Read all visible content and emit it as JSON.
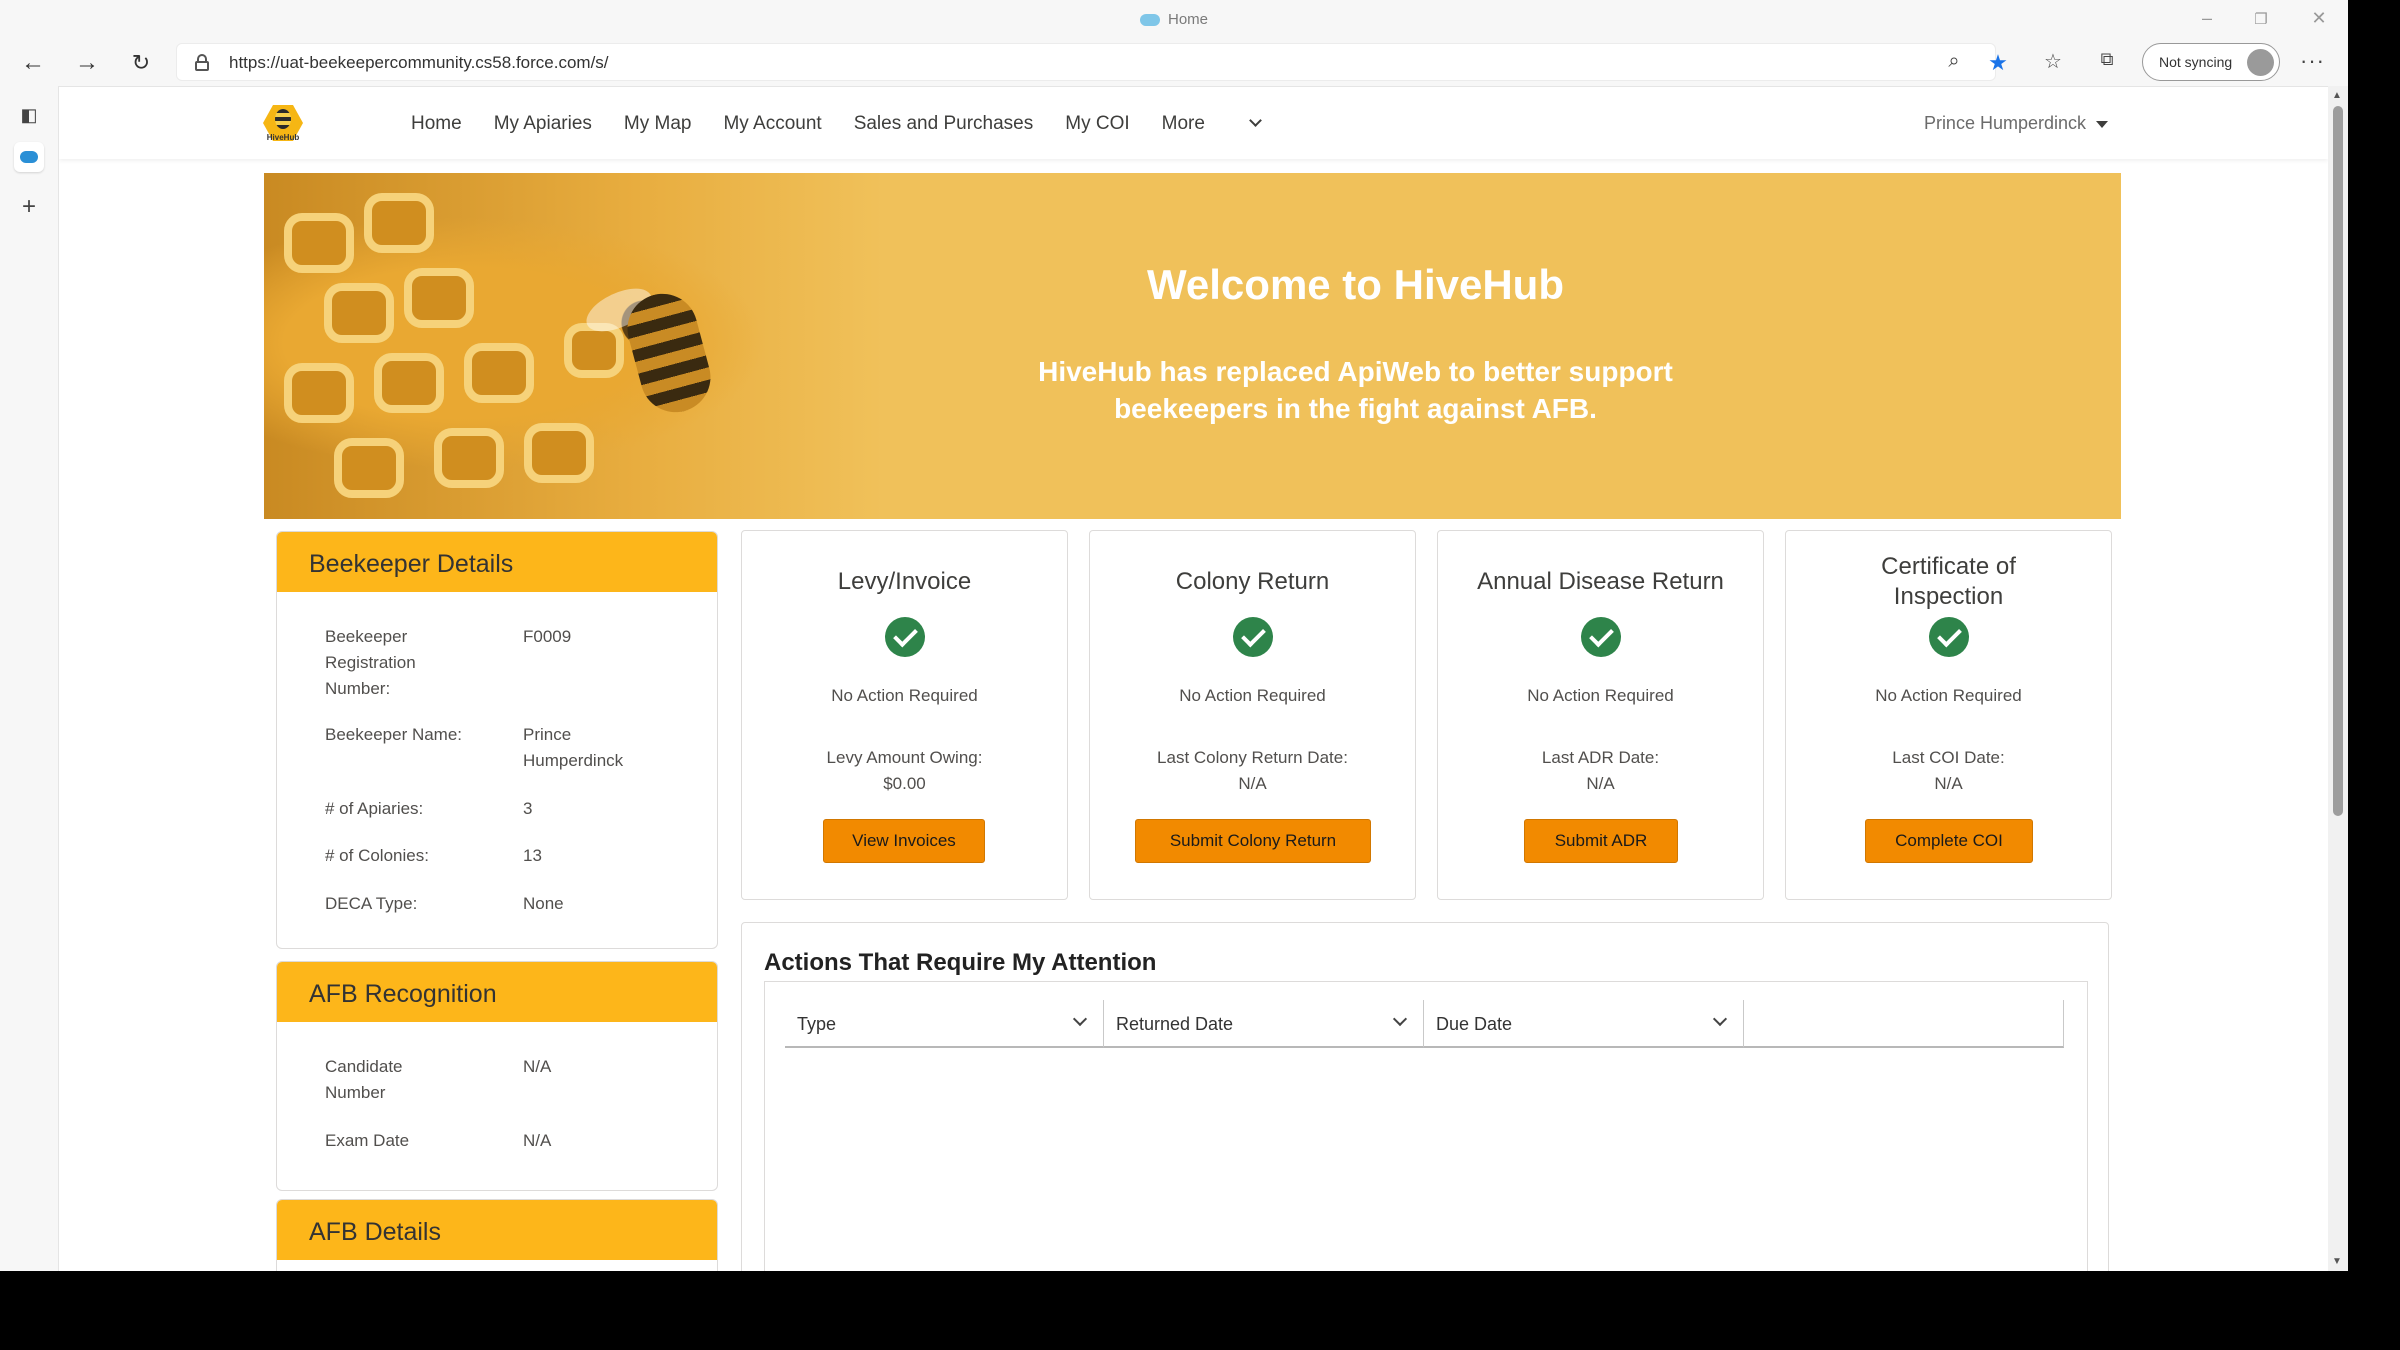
{
  "browser": {
    "title": "Home",
    "url": "https://uat-beekeepercommunity.cs58.force.com/s/",
    "sync_label": "Not syncing"
  },
  "nav": {
    "logo_text": "HiveHub",
    "items": [
      "Home",
      "My Apiaries",
      "My Map",
      "My Account",
      "Sales and Purchases",
      "My COI",
      "More"
    ],
    "user_name": "Prince Humperdinck"
  },
  "hero": {
    "title": "Welcome to HiveHub",
    "subtitle_line1": "HiveHub has replaced ApiWeb to better support",
    "subtitle_line2": "beekeepers in the fight against AFB."
  },
  "beekeeper_details": {
    "title": "Beekeeper Details",
    "rows": [
      {
        "label": "Beekeeper Registration Number:",
        "value": "F0009"
      },
      {
        "label": "Beekeeper Name:",
        "value": "Prince Humperdinck"
      },
      {
        "label": "# of Apiaries:",
        "value": "3"
      },
      {
        "label": "# of Colonies:",
        "value": "13"
      },
      {
        "label": "DECA Type:",
        "value": "None"
      }
    ]
  },
  "afb_recognition": {
    "title": "AFB Recognition",
    "rows": [
      {
        "label": "Candidate Number",
        "value": "N/A"
      },
      {
        "label": "Exam Date",
        "value": "N/A"
      }
    ]
  },
  "afb_details": {
    "title": "AFB Details"
  },
  "status_cards": [
    {
      "title": "Levy/Invoice",
      "status": "No Action Required",
      "info_line1": "Levy Amount Owing:",
      "info_line2": "$0.00",
      "button": "View Invoices"
    },
    {
      "title": "Colony Return",
      "status": "No Action Required",
      "info_line1": "Last Colony Return Date:",
      "info_line2": "N/A",
      "button": "Submit Colony Return"
    },
    {
      "title": "Annual Disease Return",
      "status": "No Action Required",
      "info_line1": "Last ADR Date:",
      "info_line2": "N/A",
      "button": "Submit ADR"
    },
    {
      "title": "Certificate of Inspection",
      "status": "No Action Required",
      "info_line1": "Last COI Date:",
      "info_line2": "N/A",
      "button": "Complete COI"
    }
  ],
  "actions": {
    "title": "Actions That Require My Attention",
    "columns": [
      "Type",
      "Returned Date",
      "Due Date",
      ""
    ]
  },
  "colors": {
    "accent": "#fdb61a",
    "button": "#f28a00",
    "success": "#2e844a",
    "hero_bg": "#f0c15a"
  }
}
